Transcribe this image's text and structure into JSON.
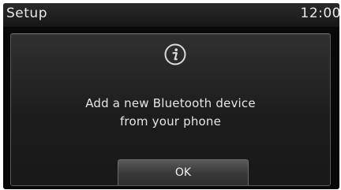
{
  "status_bar": {
    "title": "Setup",
    "clock": "12:00"
  },
  "popup": {
    "icon": "info-icon",
    "message_line1": "Add a new Bluetooth device",
    "message_line2": "from your phone",
    "ok_label": "OK"
  },
  "colors": {
    "background": "#080808",
    "text": "#e6e6e6",
    "button": "#4a4a4a"
  }
}
